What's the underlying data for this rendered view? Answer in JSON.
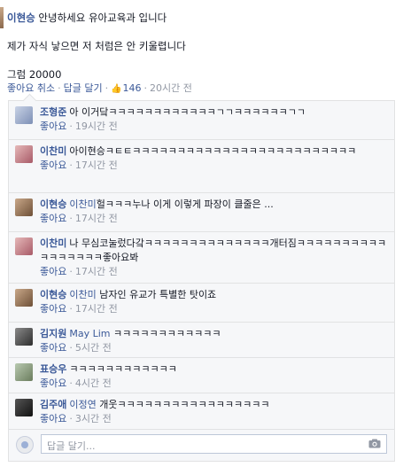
{
  "post": {
    "author": "이현승",
    "line1_text": " 안녕하세요 유아교육과 입니다",
    "line2": "제가 자식 낳으면 저 처럼은 안 키울렵니다",
    "line3": "그럼 20000",
    "actions": {
      "unlike": "좋아요 취소",
      "reply": "답글 달기",
      "likes": "146",
      "time": "20시간 전"
    }
  },
  "comments": [
    {
      "name": "조형준",
      "tag": "",
      "text": "아 이거닼ㅋㅋㅋㅋㅋㅋㅋㅋㅋㅋㅋㅋㄱㄱㅋㅋㅋㅋㅋㅋㄱㄱ",
      "like": "좋아요",
      "time": "19시간 전"
    },
    {
      "name": "이찬미",
      "tag": "",
      "text": "아이현승ㅋㅌㅌㅋㅋㅋㅋㅋㅋㅋㅋㅋㅋㅋㅋㅋㅋㅋㅋㅋㅋㅋㅋㅋㅋㅋㅋㅋ",
      "like": "좋아요",
      "time": "17시간 전"
    },
    {
      "name": "이현승",
      "tag": "이찬미",
      "text": "헐ㅋㅋㅋ누나 이게 이렇게 파장이 클줄은 ...",
      "like": "좋아요",
      "time": "17시간 전"
    },
    {
      "name": "이찬미",
      "tag": "",
      "text": "나 무심코눌렀다갘ㅋㅋㅋㅋㅋㅋㅋㅋㅋㅋㅋㅋㅋㅋ개터짐ㅋㅋㅋㅋㅋㅋㅋㅋㅋㅋㅋㅋㅋㅋㅋㅋㅋ좋아요봐",
      "like": "좋아요",
      "time": "17시간 전"
    },
    {
      "name": "이현승",
      "tag": "이찬미",
      "text": "남자인 유교가 특별한 탓이죠",
      "like": "좋아요",
      "time": "17시간 전"
    },
    {
      "name": "김지원",
      "tag": "May Lim",
      "text": "ㅋㅋㅋㅋㅋㅋㅋㅋㅋㅋㅋㅋ",
      "like": "좋아요",
      "time": "5시간 전"
    },
    {
      "name": "표승우",
      "tag": "",
      "text": "ㅋㅋㅋㅋㅋㅋㅋㅋㅋㅋㅋㅋ",
      "like": "좋아요",
      "time": "4시간 전"
    },
    {
      "name": "김주애",
      "tag": "이정연",
      "text": "개웃ㅋㅋㅋㅋㅋㅋㅋㅋㅋㅋㅋㅋㅋㅋㅋㅋㅋ",
      "like": "좋아요",
      "time": "3시간 전"
    }
  ],
  "reply_box": {
    "placeholder": "답글 달기..."
  },
  "colors": {
    "link": "#3b5998",
    "meta": "#9197a3",
    "panel": "#f6f7f9",
    "border": "#e1e2e3"
  }
}
